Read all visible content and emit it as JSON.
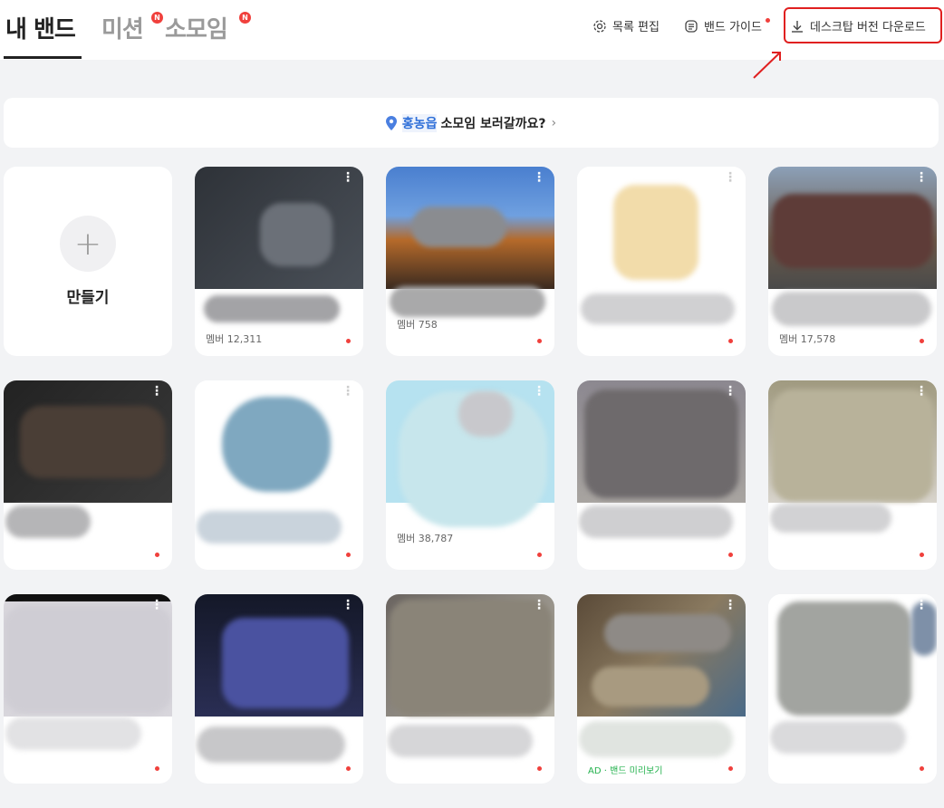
{
  "header": {
    "tabs": [
      {
        "label": "내 밴드"
      },
      {
        "label": "미션",
        "badge": "N"
      },
      {
        "label": "소모임",
        "badge": "N"
      }
    ],
    "edit_list": "목록 편집",
    "band_guide": "밴드 가이드",
    "desktop_download": "데스크탑 버전 다운로드"
  },
  "banner": {
    "location": "홍농읍",
    "text": "소모임 보러갈까요?",
    "chevron": "›"
  },
  "create": {
    "label": "만들기",
    "plus": "+"
  },
  "cards": [
    {
      "member": "멤버 12,311"
    },
    {
      "member": "멤버 758"
    },
    {
      "member": ""
    },
    {
      "member": "멤버 17,578"
    },
    {
      "member": ""
    },
    {
      "member": ""
    },
    {
      "member": "멤버 38,787"
    },
    {
      "member": ""
    },
    {
      "member": ""
    },
    {
      "member": ""
    },
    {
      "member": ""
    },
    {
      "member": ""
    },
    {
      "member": "",
      "ad": "AD · 밴드 미리보기"
    },
    {
      "member": ""
    }
  ],
  "more_glyph": "⋮",
  "colors": {
    "accent": "#f0403c",
    "link": "#2e6fd8",
    "highlight": "#e02020",
    "ad": "#22b14c"
  }
}
